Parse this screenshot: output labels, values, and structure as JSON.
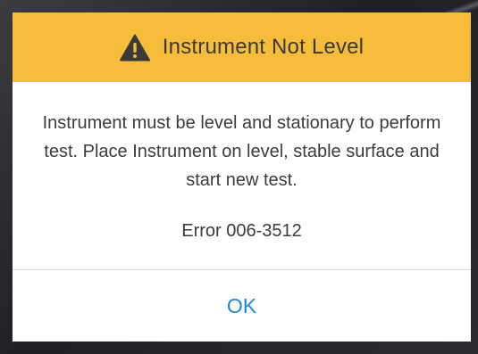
{
  "dialog": {
    "title": "Instrument Not Level",
    "title_icon": "warning-triangle-icon",
    "message": "Instrument must be level and stationary to perform test. Place Instrument on level, stable surface and start new test.",
    "error_code": "Error 006-3512",
    "ok_label": "OK"
  },
  "colors": {
    "header_background": "#f7bd3a",
    "button_text": "#1f8ad6",
    "body_text": "#3c3c3c"
  }
}
